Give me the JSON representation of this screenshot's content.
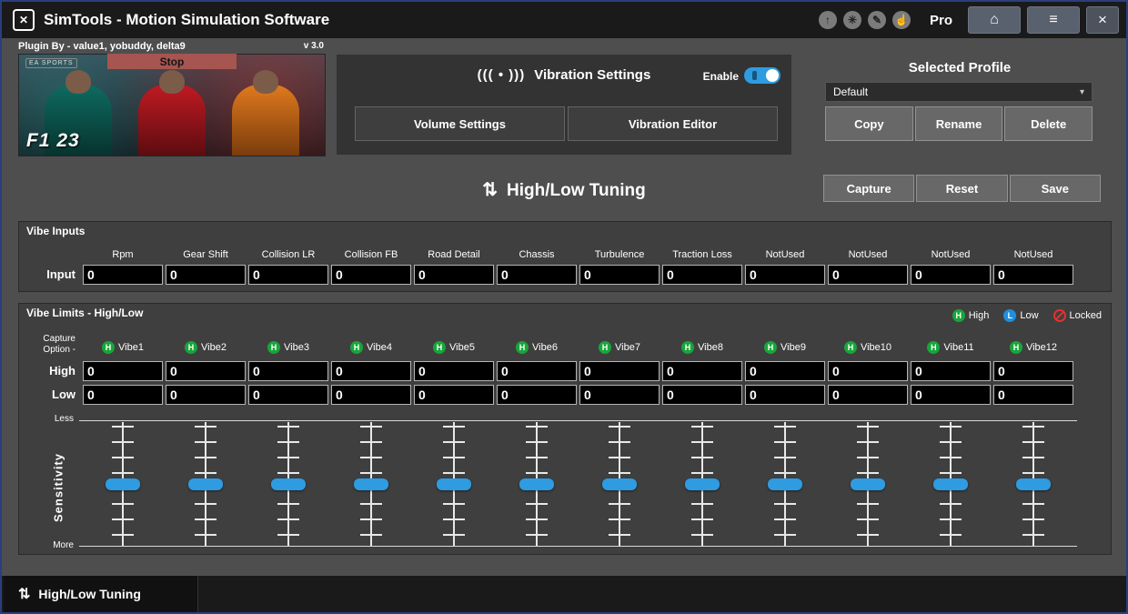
{
  "window": {
    "title": "SimTools - Motion Simulation Software",
    "pro_label": "Pro",
    "titlebar_icon_glyphs": [
      "↑",
      "✳",
      "✎",
      "☝"
    ],
    "logo_glyph": "✕",
    "home_glyph": "⌂",
    "menu_glyph": "≡",
    "close_glyph": "×"
  },
  "plugin": {
    "plugin_by": "Plugin By - value1, yobuddy, delta9",
    "version": "v 3.0",
    "stop_label": "Stop",
    "game_logo": "F1 23",
    "game_brand": "EA SPORTS"
  },
  "vibration": {
    "icon": "((( • )))",
    "title": "Vibration Settings",
    "enable_label": "Enable",
    "enabled": true,
    "volume_button": "Volume Settings",
    "editor_button": "Vibration Editor"
  },
  "profile": {
    "title": "Selected Profile",
    "selected": "Default",
    "chevron": "▾",
    "copy_button": "Copy",
    "rename_button": "Rename",
    "delete_button": "Delete"
  },
  "tuning": {
    "icon": "⇅",
    "title": "High/Low Tuning",
    "capture_button": "Capture",
    "reset_button": "Reset",
    "save_button": "Save"
  },
  "vibe_inputs": {
    "title": "Vibe Inputs",
    "row_label": "Input",
    "columns": [
      "Rpm",
      "Gear Shift",
      "Collision LR",
      "Collision FB",
      "Road Detail",
      "Chassis",
      "Turbulence",
      "Traction Loss",
      "NotUsed",
      "NotUsed",
      "NotUsed",
      "NotUsed"
    ],
    "values": [
      "0",
      "0",
      "0",
      "0",
      "0",
      "0",
      "0",
      "0",
      "0",
      "0",
      "0",
      "0"
    ]
  },
  "vibe_limits": {
    "title": "Vibe Limits - High/Low",
    "legend": {
      "high_letter": "H",
      "high": "High",
      "low_letter": "L",
      "low": "Low",
      "locked": "Locked"
    },
    "capture_option_label": "Capture\nOption -",
    "channels": [
      {
        "letter": "H",
        "label": "Vibe1"
      },
      {
        "letter": "H",
        "label": "Vibe2"
      },
      {
        "letter": "H",
        "label": "Vibe3"
      },
      {
        "letter": "H",
        "label": "Vibe4"
      },
      {
        "letter": "H",
        "label": "Vibe5"
      },
      {
        "letter": "H",
        "label": "Vibe6"
      },
      {
        "letter": "H",
        "label": "Vibe7"
      },
      {
        "letter": "H",
        "label": "Vibe8"
      },
      {
        "letter": "H",
        "label": "Vibe9"
      },
      {
        "letter": "H",
        "label": "Vibe10"
      },
      {
        "letter": "H",
        "label": "Vibe11"
      },
      {
        "letter": "H",
        "label": "Vibe12"
      }
    ],
    "high_row_label": "High",
    "low_row_label": "Low",
    "high_values": [
      "0",
      "0",
      "0",
      "0",
      "0",
      "0",
      "0",
      "0",
      "0",
      "0",
      "0",
      "0"
    ],
    "low_values": [
      "0",
      "0",
      "0",
      "0",
      "0",
      "0",
      "0",
      "0",
      "0",
      "0",
      "0",
      "0"
    ],
    "sensitivity_label": "Sensitivity",
    "less_label": "Less",
    "more_label": "More"
  },
  "footer": {
    "icon": "⇅",
    "tab_label": "High/Low Tuning"
  },
  "colors": {
    "window_border": "#2b3e7c",
    "titlebar": "#1a1a1a",
    "background": "#4e4e4e",
    "panel_dark": "#333333",
    "section_panel": "#3f3f3f",
    "field_bg": "#000000",
    "accent_blue": "#2f9be0",
    "high_green": "#17a63a",
    "low_blue": "#1f8fde",
    "locked_red": "#e03131",
    "stop_red": "#a65550"
  }
}
